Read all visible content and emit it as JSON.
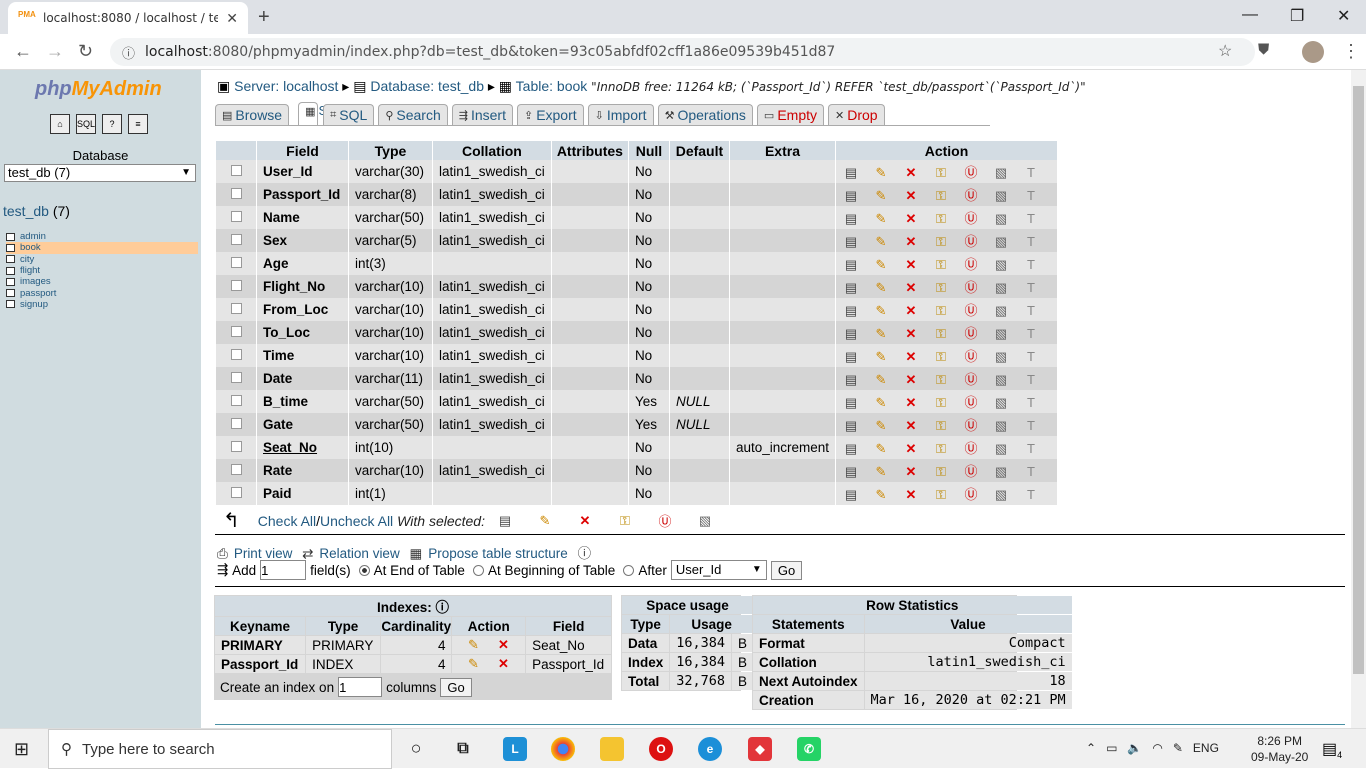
{
  "browser": {
    "tab_title": "localhost:8080 / localhost / test_d",
    "favicon": "PMA",
    "url_host": "localhost",
    "url_rest": ":8080/phpmyadmin/index.php?db=test_db&token=93c05abfdf02cff1a86e09539b451d87"
  },
  "sidebar": {
    "logo_php": "php",
    "logo_my": "MyAdmin",
    "database_label": "Database",
    "db_select": "test_db (7)",
    "db_link": "test_db",
    "db_count": "(7)",
    "tables": [
      "admin",
      "book",
      "city",
      "flight",
      "images",
      "passport",
      "signup"
    ],
    "selected": "book"
  },
  "breadcrumb": {
    "server": "Server: localhost",
    "database": "Database: test_db",
    "table": "Table: book",
    "note": "\"InnoDB free: 11264 kB; (`Passport_Id`) REFER `test_db/passport`(`Passport_Id`)\""
  },
  "tabs": [
    "Browse",
    "Structure",
    "SQL",
    "Search",
    "Insert",
    "Export",
    "Import",
    "Operations",
    "Empty",
    "Drop"
  ],
  "structure": {
    "headers": [
      "Field",
      "Type",
      "Collation",
      "Attributes",
      "Null",
      "Default",
      "Extra",
      "Action"
    ],
    "rows": [
      {
        "field": "User_Id",
        "type": "varchar(30)",
        "collation": "latin1_swedish_ci",
        "attributes": "",
        "null": "No",
        "default": "",
        "extra": ""
      },
      {
        "field": "Passport_Id",
        "type": "varchar(8)",
        "collation": "latin1_swedish_ci",
        "attributes": "",
        "null": "No",
        "default": "",
        "extra": ""
      },
      {
        "field": "Name",
        "type": "varchar(50)",
        "collation": "latin1_swedish_ci",
        "attributes": "",
        "null": "No",
        "default": "",
        "extra": ""
      },
      {
        "field": "Sex",
        "type": "varchar(5)",
        "collation": "latin1_swedish_ci",
        "attributes": "",
        "null": "No",
        "default": "",
        "extra": ""
      },
      {
        "field": "Age",
        "type": "int(3)",
        "collation": "",
        "attributes": "",
        "null": "No",
        "default": "",
        "extra": ""
      },
      {
        "field": "Flight_No",
        "type": "varchar(10)",
        "collation": "latin1_swedish_ci",
        "attributes": "",
        "null": "No",
        "default": "",
        "extra": ""
      },
      {
        "field": "From_Loc",
        "type": "varchar(10)",
        "collation": "latin1_swedish_ci",
        "attributes": "",
        "null": "No",
        "default": "",
        "extra": ""
      },
      {
        "field": "To_Loc",
        "type": "varchar(10)",
        "collation": "latin1_swedish_ci",
        "attributes": "",
        "null": "No",
        "default": "",
        "extra": ""
      },
      {
        "field": "Time",
        "type": "varchar(10)",
        "collation": "latin1_swedish_ci",
        "attributes": "",
        "null": "No",
        "default": "",
        "extra": ""
      },
      {
        "field": "Date",
        "type": "varchar(11)",
        "collation": "latin1_swedish_ci",
        "attributes": "",
        "null": "No",
        "default": "",
        "extra": ""
      },
      {
        "field": "B_time",
        "type": "varchar(50)",
        "collation": "latin1_swedish_ci",
        "attributes": "",
        "null": "Yes",
        "default": "NULL",
        "extra": ""
      },
      {
        "field": "Gate",
        "type": "varchar(50)",
        "collation": "latin1_swedish_ci",
        "attributes": "",
        "null": "Yes",
        "default": "NULL",
        "extra": ""
      },
      {
        "field": "Seat_No",
        "type": "int(10)",
        "collation": "",
        "attributes": "",
        "null": "No",
        "default": "",
        "extra": "auto_increment"
      },
      {
        "field": "Rate",
        "type": "varchar(10)",
        "collation": "latin1_swedish_ci",
        "attributes": "",
        "null": "No",
        "default": "",
        "extra": ""
      },
      {
        "field": "Paid",
        "type": "int(1)",
        "collation": "",
        "attributes": "",
        "null": "No",
        "default": "",
        "extra": ""
      }
    ]
  },
  "with_selected": {
    "check_all": "Check All",
    "sep": " / ",
    "uncheck_all": "Uncheck All",
    "label": "With selected:"
  },
  "links": {
    "print": "Print view",
    "relation": "Relation view",
    "propose": "Propose table structure"
  },
  "add_field": {
    "add": "Add",
    "count": "1",
    "fields": "field(s)",
    "end": "At End of Table",
    "beginning": "At Beginning of Table",
    "after": "After",
    "after_value": "User_Id",
    "go": "Go"
  },
  "indexes": {
    "title": "Indexes:",
    "headers": [
      "Keyname",
      "Type",
      "Cardinality",
      "Action",
      "Field"
    ],
    "rows": [
      {
        "keyname": "PRIMARY",
        "type": "PRIMARY",
        "cardinality": "4",
        "field": "Seat_No"
      },
      {
        "keyname": "Passport_Id",
        "type": "INDEX",
        "cardinality": "4",
        "field": "Passport_Id"
      }
    ],
    "create_label": "Create an index on",
    "create_value": "1",
    "columns": "columns",
    "go": "Go"
  },
  "space": {
    "title": "Space usage",
    "headers": [
      "Type",
      "Usage"
    ],
    "rows": [
      {
        "type": "Data",
        "usage": "16,384",
        "unit": "B"
      },
      {
        "type": "Index",
        "usage": "16,384",
        "unit": "B"
      },
      {
        "type": "Total",
        "usage": "32,768",
        "unit": "B"
      }
    ]
  },
  "rowstats": {
    "title": "Row Statistics",
    "headers": [
      "Statements",
      "Value"
    ],
    "rows": [
      {
        "s": "Format",
        "v": "Compact"
      },
      {
        "s": "Collation",
        "v": "latin1_swedish_ci"
      },
      {
        "s": "Next Autoindex",
        "v": "18"
      },
      {
        "s": "Creation",
        "v": "Mar 16, 2020 at 02:21 PM"
      }
    ]
  },
  "taskbar": {
    "search": "Type here to search",
    "lang": "ENG",
    "time": "8:26 PM",
    "date": "09-May-20",
    "notif_count": "4"
  }
}
